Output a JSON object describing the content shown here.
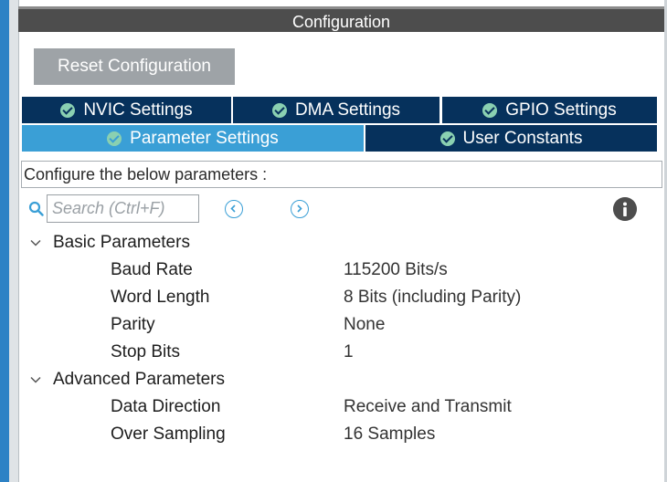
{
  "window": {
    "title": "Configuration"
  },
  "toolbar": {
    "reset_label": "Reset Configuration"
  },
  "tabs": [
    {
      "label": "NVIC Settings",
      "active": false
    },
    {
      "label": "DMA Settings",
      "active": false
    },
    {
      "label": "GPIO Settings",
      "active": false
    },
    {
      "label": "Parameter Settings",
      "active": true
    },
    {
      "label": "User Constants",
      "active": false
    }
  ],
  "description": "Configure the below parameters :",
  "search": {
    "placeholder": "Search (Ctrl+F)"
  },
  "sections": [
    {
      "title": "Basic Parameters",
      "params": [
        {
          "name": "Baud Rate",
          "value": "115200 Bits/s"
        },
        {
          "name": "Word Length",
          "value": "8 Bits (including Parity)"
        },
        {
          "name": "Parity",
          "value": "None"
        },
        {
          "name": "Stop Bits",
          "value": "1"
        }
      ]
    },
    {
      "title": "Advanced Parameters",
      "params": [
        {
          "name": "Data Direction",
          "value": "Receive and Transmit"
        },
        {
          "name": "Over Sampling",
          "value": "16 Samples"
        }
      ]
    }
  ],
  "colors": {
    "tab_bg": "#06315c",
    "tab_active": "#3a9fd6",
    "check": "#8ad0b1",
    "title_bar": "#4d4d4d",
    "button": "#9ea3a7"
  }
}
